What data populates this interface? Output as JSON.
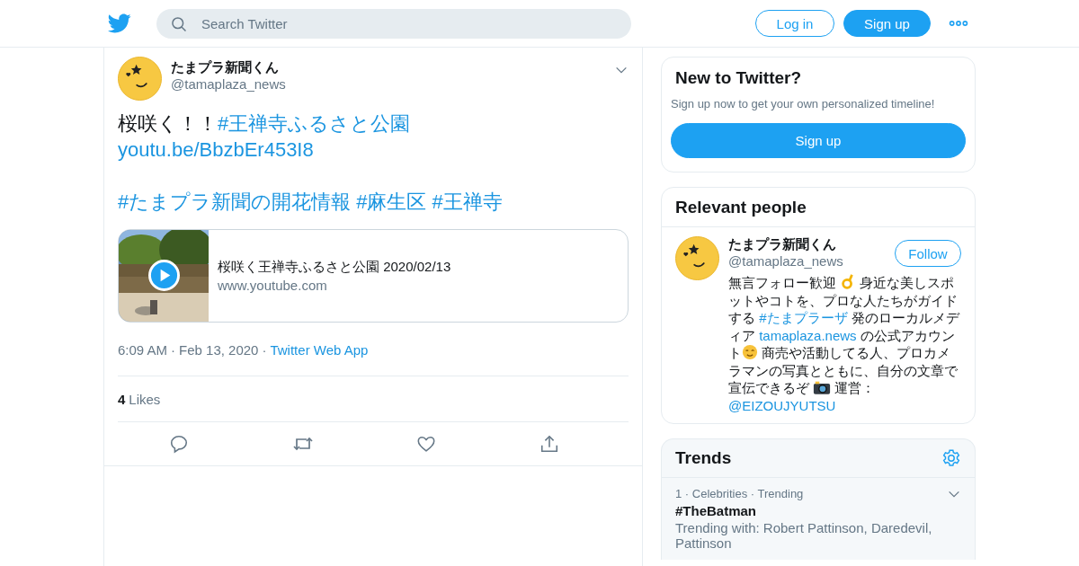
{
  "header": {
    "search_placeholder": "Search Twitter",
    "login": "Log in",
    "signup": "Sign up"
  },
  "tweet": {
    "name": "たまプラ新聞くん",
    "handle": "@tamaplaza_news",
    "paragraphs": [
      [
        [
          {
            "kind": "text",
            "text": "桜咲く！！"
          },
          {
            "kind": "link",
            "text": "#王禅寺ふるさと公園"
          }
        ],
        [
          {
            "kind": "link",
            "text": "youtu.be/BbzbEr453I8"
          }
        ]
      ],
      [
        [
          {
            "kind": "link",
            "text": "#たまプラ新聞の開花情報"
          },
          {
            "kind": "link",
            "text": "#麻生区",
            "space_before": true
          },
          {
            "kind": "link",
            "text": "#王禅寺",
            "space_before": true
          }
        ]
      ]
    ],
    "card": {
      "title": "桜咲く王禅寺ふるさと公園 2020/02/13",
      "domain": "www.youtube.com"
    },
    "time": "6:09 AM",
    "separator_1": "·",
    "date": "Feb 13, 2020",
    "separator_2": "·",
    "source": "Twitter Web App",
    "like_count": "4",
    "likes_label": "Likes"
  },
  "new_to_twitter": {
    "title": "New to Twitter?",
    "subtitle": "Sign up now to get your own personalized timeline!",
    "button": "Sign up"
  },
  "relevant_people": {
    "title": "Relevant people",
    "people": [
      {
        "name": "たまプラ新聞くん",
        "handle": "@tamaplaza_news",
        "button": "Follow",
        "bio": [
          {
            "kind": "text",
            "text": "無言フォロー歓迎 "
          },
          {
            "kind": "emoji"
          },
          {
            "kind": "text",
            "text": " 身近な美しスポットやコトを、プロな人たちがガイドする "
          },
          {
            "kind": "link",
            "text": "#たまプラーザ"
          },
          {
            "kind": "text",
            "text": " 発のローカルメディア "
          },
          {
            "kind": "link",
            "text": "tamaplaza.news"
          },
          {
            "kind": "text",
            "text": " の公式アカウント"
          },
          {
            "kind": "emoji"
          },
          {
            "kind": "text",
            "text": " 商売や活動してる人、プロカメラマンの写真とともに、自分の文章で宣伝できるぞ "
          },
          {
            "kind": "emoji"
          },
          {
            "kind": "text",
            "text": " 運営："
          },
          {
            "kind": "link",
            "text": "@EIZOUJYUTSU"
          }
        ]
      }
    ]
  },
  "trends": {
    "title": "Trends",
    "items": [
      {
        "meta": "1 · Celebrities · Trending",
        "name": "#TheBatman",
        "context": "Trending with: Robert Pattinson, Daredevil, Pattinson"
      }
    ]
  }
}
